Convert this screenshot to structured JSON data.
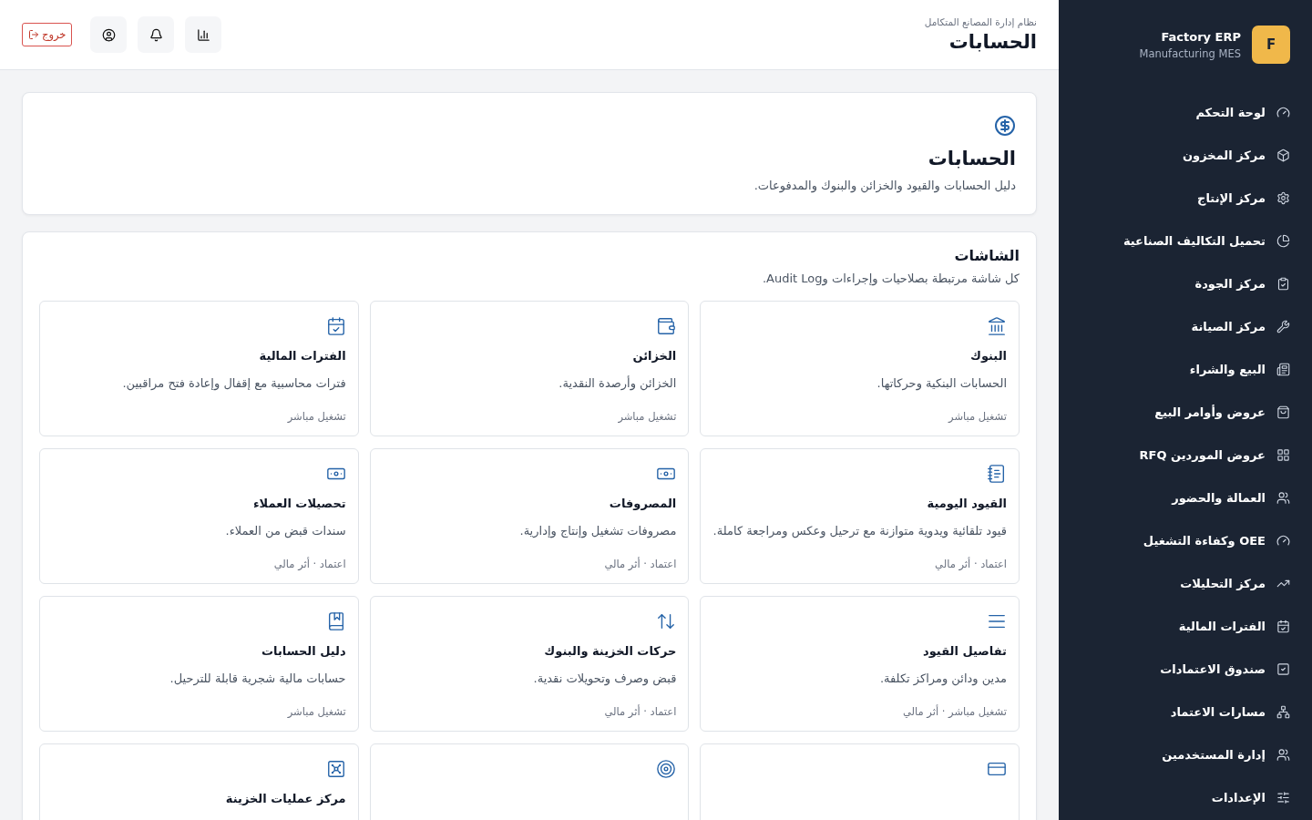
{
  "sidebar": {
    "brand": {
      "logo": "F",
      "title": "Factory ERP",
      "subtitle": "Manufacturing MES"
    },
    "items": [
      {
        "label": "لوحة التحكم"
      },
      {
        "label": "مركز المخزون"
      },
      {
        "label": "مركز الإنتاج"
      },
      {
        "label": "تحميل التكاليف الصناعية"
      },
      {
        "label": "مركز الجودة"
      },
      {
        "label": "مركز الصيانة"
      },
      {
        "label": "البيع والشراء"
      },
      {
        "label": "عروض وأوامر البيع"
      },
      {
        "label": "عروض الموردين RFQ"
      },
      {
        "label": "العمالة والحضور"
      },
      {
        "label": "OEE وكفاءة التشغيل"
      },
      {
        "label": "مركز التحليلات"
      },
      {
        "label": "الفترات المالية"
      },
      {
        "label": "صندوق الاعتمادات"
      },
      {
        "label": "مسارات الاعتماد"
      },
      {
        "label": "إدارة المستخدمين"
      },
      {
        "label": "الإعدادات"
      }
    ]
  },
  "header": {
    "subtitle": "نظام إدارة المصانع المتكامل",
    "title": "الحسابات",
    "logout": "خروج"
  },
  "hero": {
    "title": "الحسابات",
    "description": "دليل الحسابات والقيود والخزائن والبنوك والمدفوعات."
  },
  "screens": {
    "title": "الشاشات",
    "description": "كل شاشة مرتبطة بصلاحيات وإجراءات وAudit Log.",
    "cards": [
      {
        "kind": "full",
        "title": "البنوك",
        "description": "الحسابات البنكية وحركاتها.",
        "meta": "تشغيل مباشر"
      },
      {
        "kind": "full",
        "title": "الخزائن",
        "description": "الخزائن وأرصدة النقدية.",
        "meta": "تشغيل مباشر"
      },
      {
        "kind": "full",
        "title": "الفترات المالية",
        "description": "فترات محاسبية مع إقفال وإعادة فتح مراقبين.",
        "meta": "تشغيل مباشر"
      },
      {
        "kind": "full",
        "title": "القيود اليومية",
        "description": "قيود تلقائية ويدوية متوازنة مع ترحيل وعكس ومراجعة كاملة.",
        "meta": "اعتماد · أثر مالي"
      },
      {
        "kind": "full",
        "title": "المصروفات",
        "description": "مصروفات تشغيل وإنتاج وإدارية.",
        "meta": "اعتماد · أثر مالي"
      },
      {
        "kind": "full",
        "title": "تحصيلات العملاء",
        "description": "سندات قبض من العملاء.",
        "meta": "اعتماد · أثر مالي"
      },
      {
        "kind": "full",
        "title": "تفاصيل القيود",
        "description": "مدين ودائن ومراكز تكلفة.",
        "meta": "تشغيل مباشر · أثر مالي"
      },
      {
        "kind": "full",
        "title": "حركات الخزينة والبنوك",
        "description": "قبض وصرف وتحويلات نقدية.",
        "meta": "اعتماد · أثر مالي"
      },
      {
        "kind": "full",
        "title": "دليل الحسابات",
        "description": "حسابات مالية شجرية قابلة للترحيل.",
        "meta": "تشغيل مباشر"
      },
      {
        "kind": "cut"
      },
      {
        "kind": "cut"
      },
      {
        "kind": "cut",
        "title": "مركز عمليات الخزينة"
      }
    ]
  }
}
